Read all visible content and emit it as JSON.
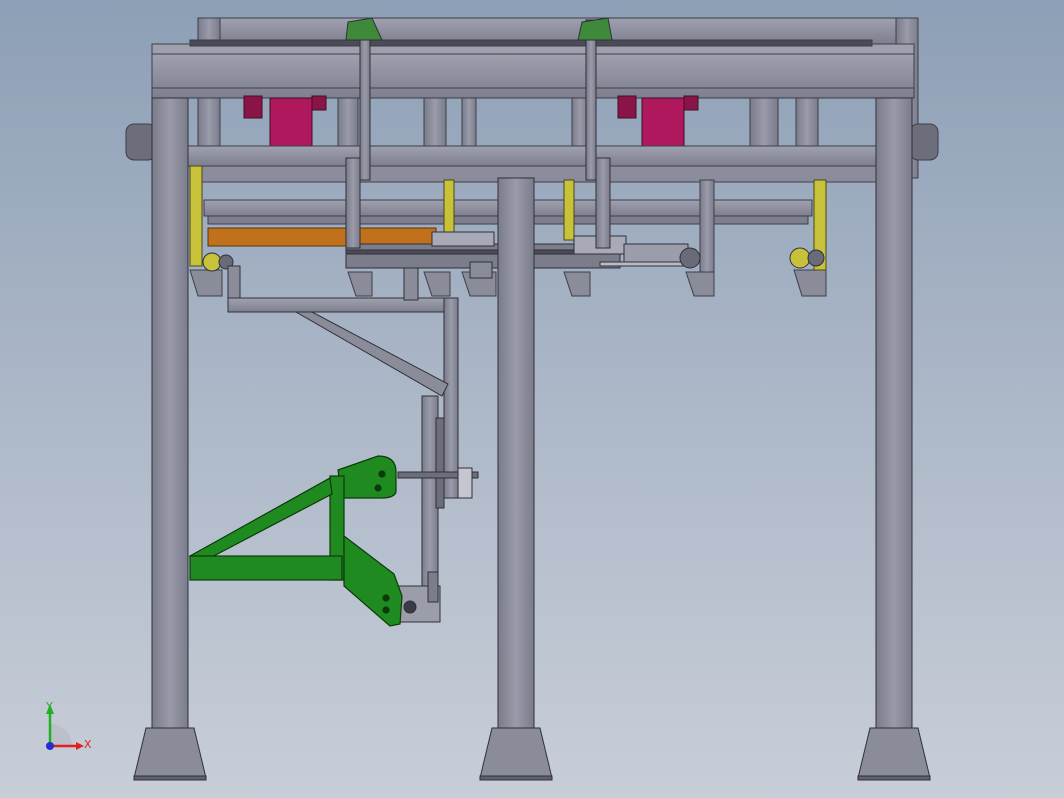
{
  "viewport": {
    "background_top": "#8d9fb6",
    "background_bottom": "#c8ced8"
  },
  "colors": {
    "steel": "#8e8e9c",
    "steel_dark": "#5f6070",
    "motor": "#b0185e",
    "yellow_bracket": "#c8c23a",
    "orange_rail": "#c1711c",
    "green_arm": "#1f8a1f",
    "axis_x": "#e02020",
    "axis_y": "#20b020",
    "axis_z": "#2030d0"
  },
  "triad": {
    "x_label": "X",
    "y_label": "Y"
  }
}
